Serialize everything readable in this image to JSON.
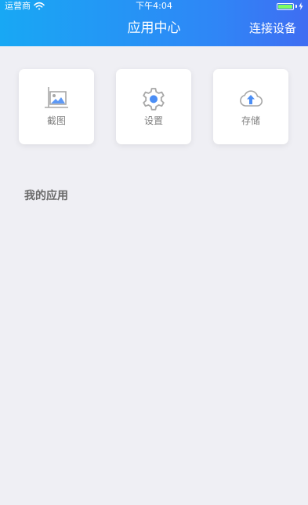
{
  "status_bar": {
    "carrier": "运营商",
    "time": "下午4:04",
    "battery": 1.0
  },
  "nav": {
    "title": "应用中心",
    "right_action": "连接设备"
  },
  "apps": [
    {
      "label": "截图",
      "icon": "screenshot-icon"
    },
    {
      "label": "设置",
      "icon": "gear-icon"
    },
    {
      "label": "存储",
      "icon": "cloud-upload-icon"
    }
  ],
  "section": {
    "title": "我的应用"
  },
  "colors": {
    "header_start": "#18a8f4",
    "header_end": "#3f6df2",
    "page_bg": "#efeff4",
    "tile_bg": "#ffffff",
    "label_gray": "#808080",
    "icon_blue": "#4b8ef5"
  }
}
